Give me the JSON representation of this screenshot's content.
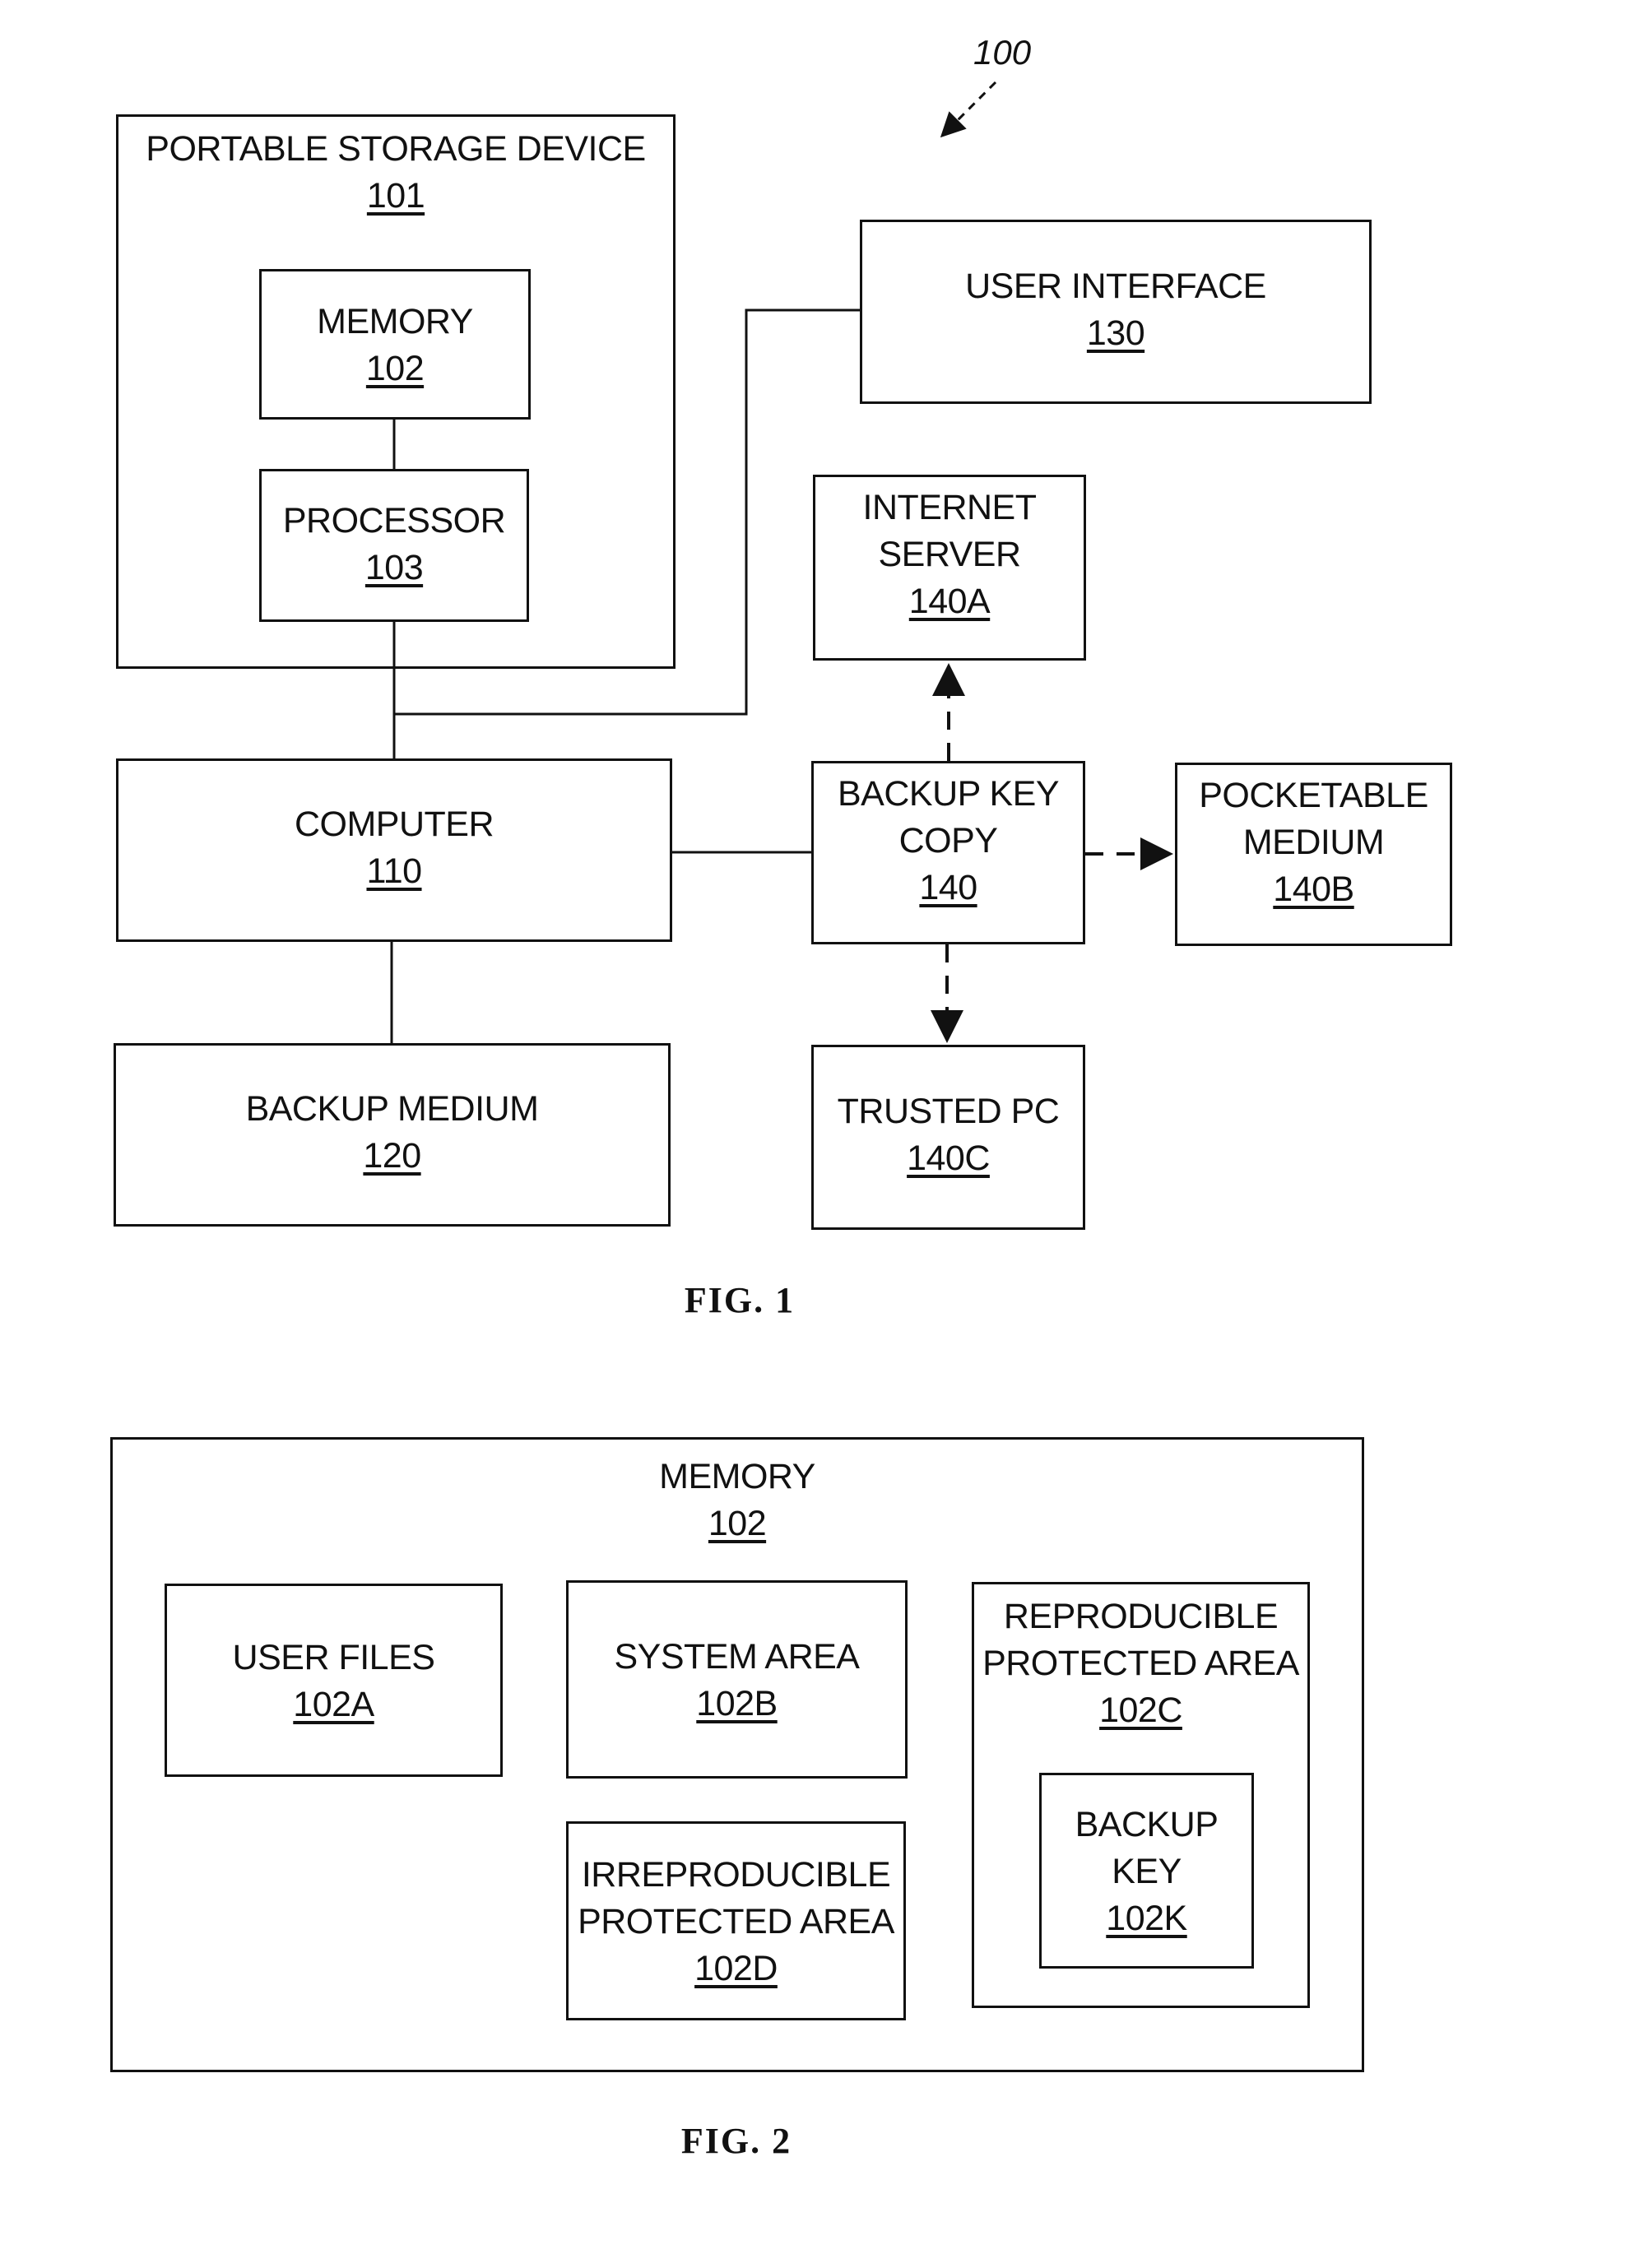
{
  "figure_ref": "100",
  "fig1": {
    "caption": "FIG. 1",
    "portable_storage": {
      "label": "PORTABLE STORAGE DEVICE",
      "ref": "101"
    },
    "memory": {
      "label": "MEMORY",
      "ref": "102"
    },
    "processor": {
      "label": "PROCESSOR",
      "ref": "103"
    },
    "user_interface": {
      "label": "USER INTERFACE",
      "ref": "130"
    },
    "internet_server": {
      "label1": "INTERNET",
      "label2": "SERVER",
      "ref": "140A"
    },
    "computer": {
      "label": "COMPUTER",
      "ref": "110"
    },
    "backup_key_copy": {
      "label1": "BACKUP KEY",
      "label2": "COPY",
      "ref": "140"
    },
    "pocketable_medium": {
      "label1": "POCKETABLE",
      "label2": "MEDIUM",
      "ref": "140B"
    },
    "backup_medium": {
      "label": "BACKUP MEDIUM",
      "ref": "120"
    },
    "trusted_pc": {
      "label": "TRUSTED PC",
      "ref": "140C"
    }
  },
  "fig2": {
    "caption": "FIG. 2",
    "memory": {
      "label": "MEMORY",
      "ref": "102"
    },
    "user_files": {
      "label": "USER FILES",
      "ref": "102A"
    },
    "system_area": {
      "label": "SYSTEM AREA",
      "ref": "102B"
    },
    "irreproducible": {
      "label1": "IRREPRODUCIBLE",
      "label2": "PROTECTED AREA",
      "ref": "102D"
    },
    "reproducible": {
      "label1": "REPRODUCIBLE",
      "label2": "PROTECTED AREA",
      "ref": "102C"
    },
    "backup_key": {
      "label1": "BACKUP",
      "label2": "KEY",
      "ref": "102K"
    }
  }
}
